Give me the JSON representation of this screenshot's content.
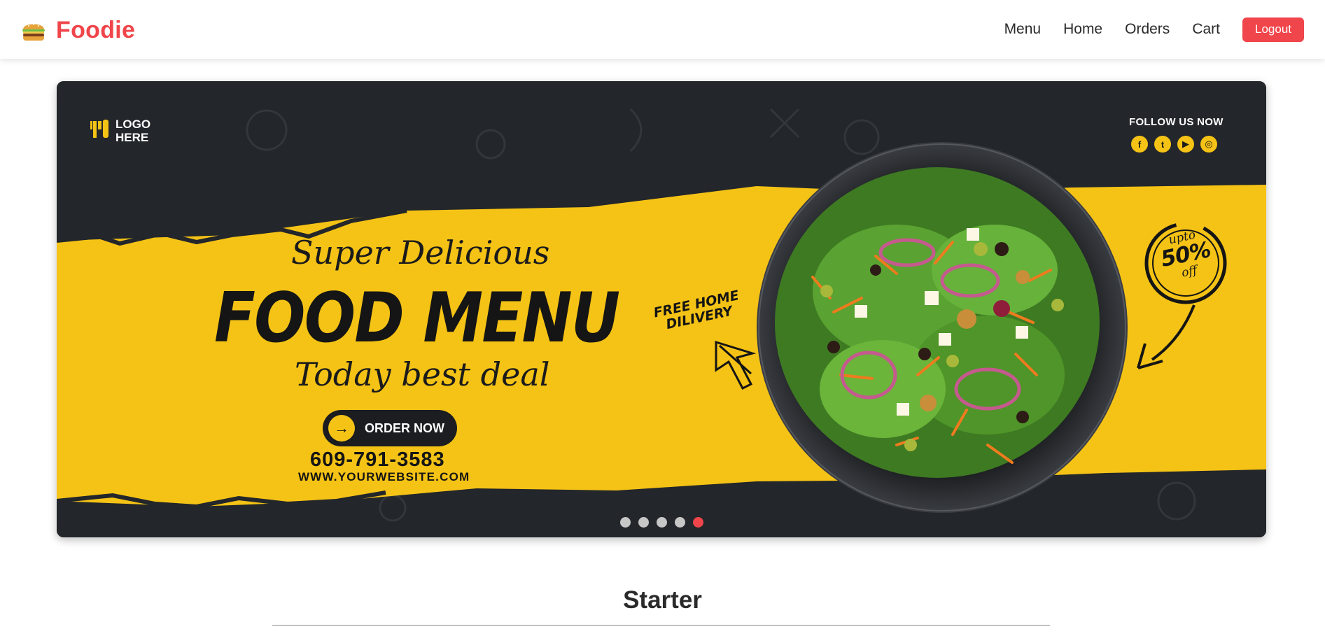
{
  "header": {
    "brand": "Foodie",
    "brand_icon": "burger-icon",
    "nav": [
      {
        "label": "Menu"
      },
      {
        "label": "Home"
      },
      {
        "label": "Orders"
      },
      {
        "label": "Cart"
      }
    ],
    "logout_label": "Logout"
  },
  "banner": {
    "logo_line1": "LOGO",
    "logo_line2": "HERE",
    "follow_label": "FOLLOW US NOW",
    "social_icons": [
      "facebook-icon",
      "twitter-icon",
      "youtube-icon",
      "instagram-icon"
    ],
    "tagline_top": "Super Delicious",
    "headline": "FOOD MENU",
    "tagline_bottom": "Today best deal",
    "order_button": "ORDER NOW",
    "phone": "609-791-3583",
    "website": "WWW.YOURWEBSITE.COM",
    "free_delivery_line1": "FREE HOME",
    "free_delivery_line2": "DILIVERY",
    "discount_upto": "upto",
    "discount_value": "50%",
    "discount_off": "off"
  },
  "carousel": {
    "slide_count": 5,
    "active_index": 4
  },
  "section": {
    "title": "Starter"
  },
  "colors": {
    "brand": "#f0454a",
    "banner_yellow": "#f5c315",
    "banner_dark": "#23262a"
  }
}
